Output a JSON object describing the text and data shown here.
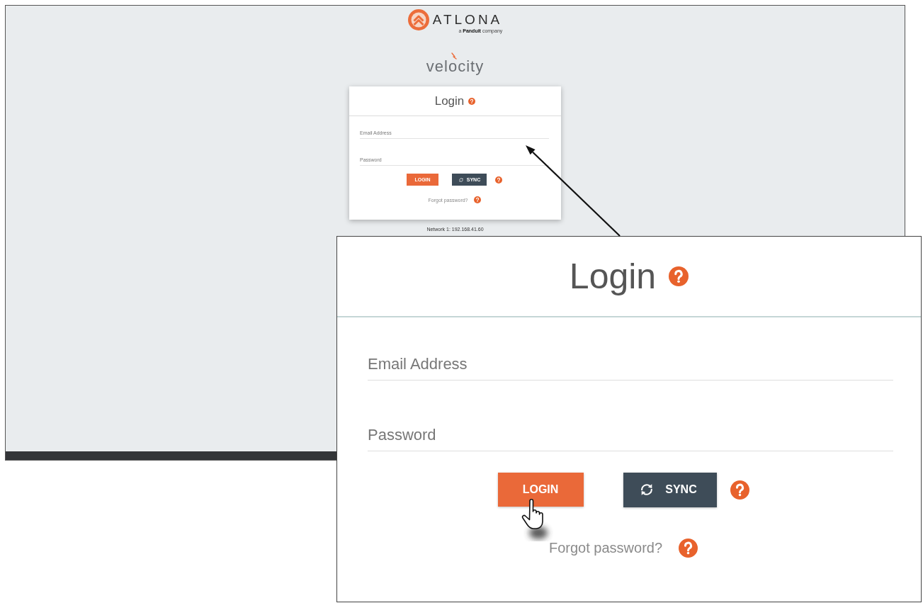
{
  "screen": {
    "brand": {
      "name": "ATLONA",
      "tagline": "a **Panduit** company"
    },
    "product": "velocity",
    "login_card": {
      "title": "Login",
      "fields": [
        {
          "placeholder": "Email Address"
        },
        {
          "placeholder": "Password"
        }
      ],
      "buttons": [
        {
          "kind": "primary",
          "label": "LOGIN"
        },
        {
          "kind": "sync",
          "label": "SYNC"
        }
      ],
      "forgot_link": "Forgot password?"
    },
    "network": "Network 1: 192.168.41.60"
  },
  "callout": {
    "login_card": {
      "title": "Login",
      "fields": [
        {
          "placeholder": "Email Address"
        },
        {
          "placeholder": "Password"
        }
      ],
      "buttons": [
        {
          "kind": "primary",
          "label": "LOGIN"
        },
        {
          "kind": "sync",
          "label": "SYNC"
        }
      ],
      "forgot_link": "Forgot password?"
    }
  }
}
